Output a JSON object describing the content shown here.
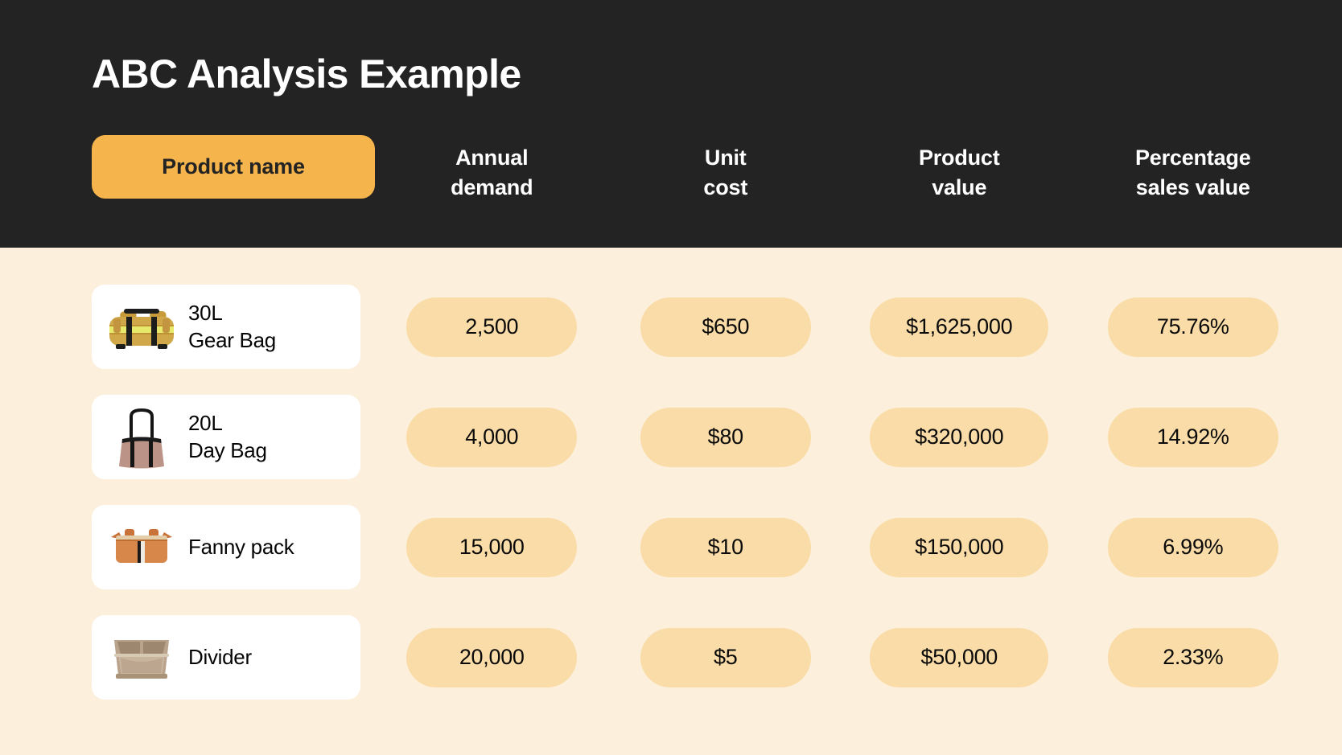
{
  "page": {
    "title": "ABC Analysis Example",
    "background_color": "#FCEFDC",
    "header_color": "#232323",
    "accent_color": "#F5B54C",
    "pill_color": "#F9DCA7"
  },
  "columns": {
    "product_name": "Product name",
    "annual_demand_line1": "Annual",
    "annual_demand_line2": "demand",
    "unit_cost_line1": "Unit",
    "unit_cost_line2": "cost",
    "product_value_line1": "Product",
    "product_value_line2": "value",
    "percentage_line1": "Percentage",
    "percentage_line2": "sales value"
  },
  "chart_data": {
    "type": "table",
    "title": "ABC Analysis Example",
    "columns": [
      "Product name",
      "Annual demand",
      "Unit cost",
      "Product value",
      "Percentage sales value"
    ],
    "rows": [
      {
        "product": "30L\nGear Bag",
        "image": "gear-bag-duffel",
        "annual_demand": "2,500",
        "unit_cost": "$650",
        "product_value": "$1,625,000",
        "percentage_sales_value": "75.76%",
        "annual_demand_num": 2500,
        "unit_cost_num": 650,
        "product_value_num": 1625000,
        "percentage_num": 75.76
      },
      {
        "product": "20L\nDay Bag",
        "image": "day-bag-tote",
        "annual_demand": "4,000",
        "unit_cost": "$80",
        "product_value": "$320,000",
        "percentage_sales_value": "14.92%",
        "annual_demand_num": 4000,
        "unit_cost_num": 80,
        "product_value_num": 320000,
        "percentage_num": 14.92
      },
      {
        "product": "Fanny pack",
        "image": "fanny-pack",
        "annual_demand": "15,000",
        "unit_cost": "$10",
        "product_value": "$150,000",
        "percentage_sales_value": "6.99%",
        "annual_demand_num": 15000,
        "unit_cost_num": 10,
        "product_value_num": 150000,
        "percentage_num": 6.99
      },
      {
        "product": "Divider",
        "image": "bag-divider-organizer",
        "annual_demand": "20,000",
        "unit_cost": "$5",
        "product_value": "$50,000",
        "percentage_sales_value": "2.33%",
        "annual_demand_num": 20000,
        "unit_cost_num": 5,
        "product_value_num": 50000,
        "percentage_num": 2.33
      }
    ]
  }
}
